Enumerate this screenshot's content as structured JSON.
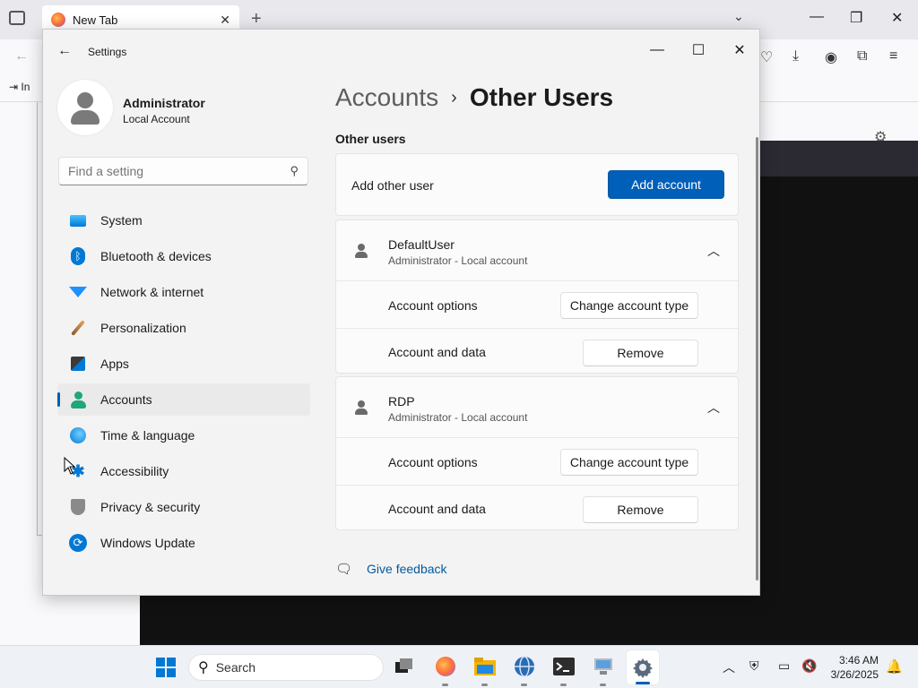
{
  "browser": {
    "tab_title": "New Tab",
    "tab_close": "✕",
    "new_tab": "+",
    "bookmark_item": "In",
    "win_minimize": "—",
    "win_restore": "❐",
    "win_close": "✕"
  },
  "settings": {
    "app_title": "Settings",
    "window_controls": {
      "minimize": "—",
      "maximize": "☐",
      "close": "✕"
    },
    "profile": {
      "name": "Administrator",
      "subtitle": "Local Account"
    },
    "search": {
      "placeholder": "Find a setting"
    },
    "nav": [
      {
        "label": "System",
        "icon": "system-icon"
      },
      {
        "label": "Bluetooth & devices",
        "icon": "bluetooth-icon"
      },
      {
        "label": "Network & internet",
        "icon": "network-icon"
      },
      {
        "label": "Personalization",
        "icon": "personalization-icon"
      },
      {
        "label": "Apps",
        "icon": "apps-icon"
      },
      {
        "label": "Accounts",
        "icon": "accounts-icon",
        "active": true
      },
      {
        "label": "Time & language",
        "icon": "time-language-icon"
      },
      {
        "label": "Accessibility",
        "icon": "accessibility-icon"
      },
      {
        "label": "Privacy & security",
        "icon": "privacy-icon"
      },
      {
        "label": "Windows Update",
        "icon": "windows-update-icon"
      }
    ],
    "breadcrumb": {
      "parent": "Accounts",
      "separator": "›",
      "current": "Other Users"
    },
    "section_title": "Other users",
    "add_user": {
      "label": "Add other user",
      "button": "Add account"
    },
    "users": [
      {
        "name": "DefaultUser",
        "role": "Administrator - Local account",
        "options_label": "Account options",
        "options_button": "Change account type",
        "data_label": "Account and data",
        "data_button": "Remove"
      },
      {
        "name": "RDP",
        "role": "Administrator - Local account",
        "options_label": "Account options",
        "options_button": "Change account type",
        "data_label": "Account and data",
        "data_button": "Remove"
      }
    ],
    "feedback": "Give feedback",
    "accent_color": "#005fb8"
  },
  "taskbar": {
    "search_label": "Search",
    "time": "3:46 AM",
    "date": "3/26/2025"
  }
}
